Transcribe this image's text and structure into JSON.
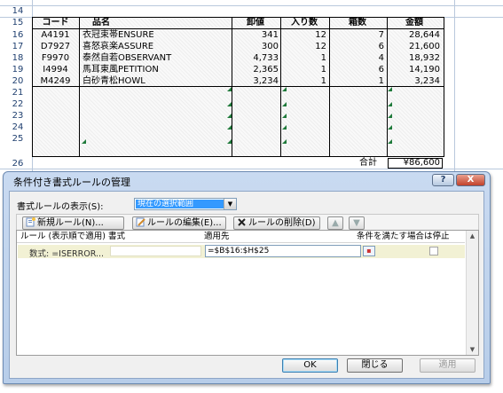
{
  "sheet": {
    "row_numbers": [
      "14",
      "15",
      "16",
      "17",
      "18",
      "19",
      "20",
      "21",
      "22",
      "23",
      "24",
      "25",
      "26"
    ],
    "headers": {
      "code": "コード",
      "name": "品名",
      "price": "卸値",
      "qty": "入り数",
      "box": "箱数",
      "amount": "金額"
    },
    "rows": [
      {
        "code": "A4191",
        "name": "衣冠束帯ENSURE",
        "price": "341",
        "qty": "12",
        "box": "7",
        "amount": "28,644"
      },
      {
        "code": "D7927",
        "name": "喜怒哀楽ASSURE",
        "price": "300",
        "qty": "12",
        "box": "6",
        "amount": "21,600"
      },
      {
        "code": "F9970",
        "name": "泰然自若OBSERVANT",
        "price": "4,733",
        "qty": "1",
        "box": "4",
        "amount": "18,932"
      },
      {
        "code": "I4994",
        "name": "馬耳東風PETITION",
        "price": "2,365",
        "qty": "1",
        "box": "6",
        "amount": "14,190"
      },
      {
        "code": "M4249",
        "name": "白砂青松HOWL",
        "price": "3,234",
        "qty": "1",
        "box": "1",
        "amount": "3,234"
      }
    ],
    "total_label": "合計",
    "total_value": "¥86,600"
  },
  "dialog": {
    "title": "条件付き書式ルールの管理",
    "help_glyph": "?",
    "close_glyph": "X",
    "show_rules_label": "書式ルールの表示(S):",
    "show_rules_value": "現在の選択範囲",
    "buttons": {
      "new_rule": "新規ルール(N)...",
      "edit_rule": "ルールの編集(E)...",
      "delete_rule": "ルールの削除(D)",
      "move_up": "▲",
      "move_down": "▼"
    },
    "columns": {
      "rule": "ルール (表示順で適用)",
      "format": "書式",
      "applies_to": "適用先",
      "stop_if_true": "条件を満たす場合は停止"
    },
    "rule": {
      "name": "数式: =ISERROR...",
      "applies_to": "=$B$16:$H$25"
    },
    "footer": {
      "ok": "OK",
      "close": "閉じる",
      "apply": "適用"
    }
  }
}
